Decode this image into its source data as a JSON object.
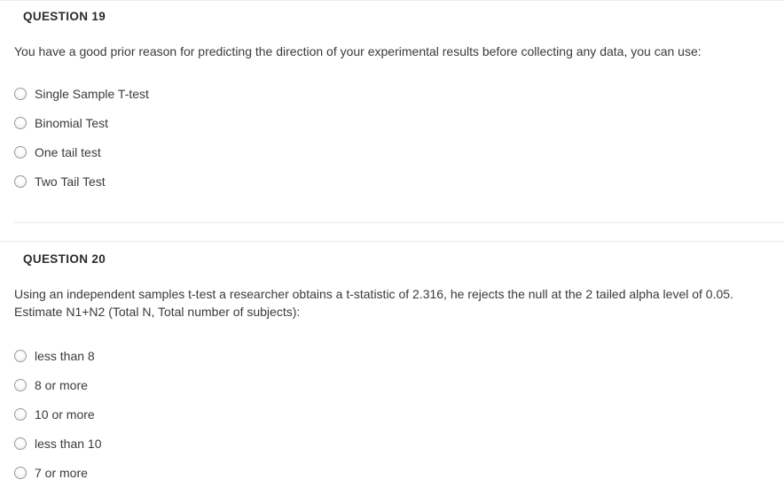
{
  "questions": [
    {
      "heading": "QUESTION 19",
      "body_lines": [
        "You have a good prior reason for predicting the direction of your experimental results before collecting any data, you can use:"
      ],
      "options": [
        {
          "label": "Single Sample T-test",
          "selected": false
        },
        {
          "label": "Binomial Test",
          "selected": false
        },
        {
          "label": "One tail test",
          "selected": false
        },
        {
          "label": "Two Tail Test",
          "selected": false
        }
      ]
    },
    {
      "heading": "QUESTION 20",
      "body_lines": [
        "Using an independent samples t-test a researcher obtains a t-statistic of 2.316, he rejects the null at the 2 tailed alpha level of 0.05.",
        "Estimate N1+N2 (Total N, Total number of subjects):"
      ],
      "options": [
        {
          "label": "less than 8",
          "selected": false
        },
        {
          "label": "8 or more",
          "selected": false
        },
        {
          "label": "10 or more",
          "selected": false
        },
        {
          "label": "less than 10",
          "selected": false
        },
        {
          "label": "7 or more",
          "selected": false
        }
      ]
    }
  ],
  "icons": {
    "radio": "radio-button-unselected-icon"
  },
  "colors": {
    "background": "#ffffff",
    "text": "#3a3a3a",
    "heading": "#2b2b2b",
    "divider": "#e8eaeb",
    "radio_border": "#9a9a9a"
  }
}
